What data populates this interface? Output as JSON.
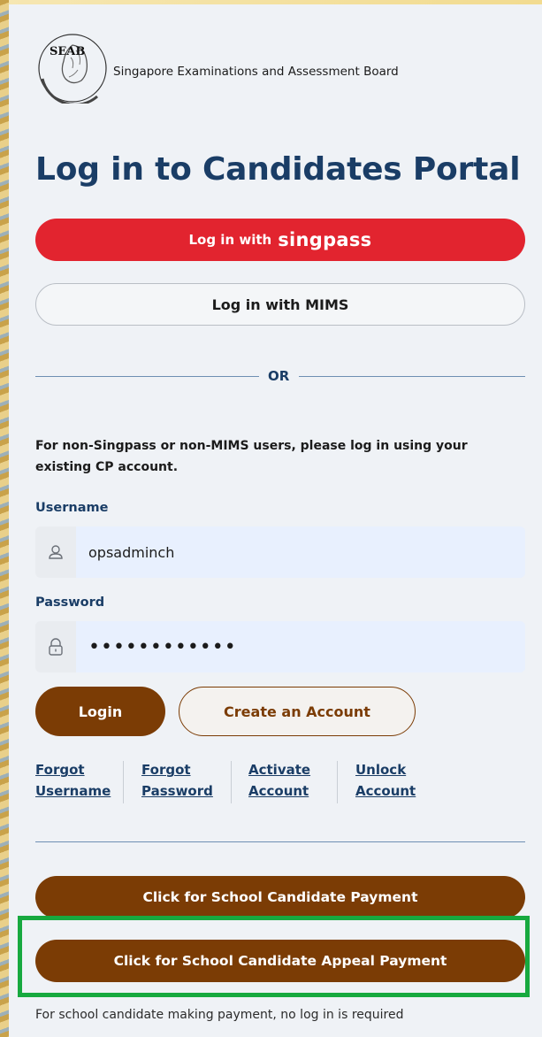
{
  "header": {
    "logo_text": "SEAB",
    "org_name": "Singapore Examinations and Assessment Board"
  },
  "page_title": "Log in to Candidates Portal",
  "singpass_button": {
    "prefix": "Log in with",
    "brand": "singpass"
  },
  "mims_button": {
    "label": "Log in with MIMS"
  },
  "divider_text": "OR",
  "info_text": "For non-Singpass or non-MIMS users, please log in using your existing CP account.",
  "username": {
    "label": "Username",
    "value": "opsadminch",
    "icon": "user-icon"
  },
  "password": {
    "label": "Password",
    "value": "••••••••••••",
    "icon": "lock-icon"
  },
  "login_button": "Login",
  "create_account_button": "Create an Account",
  "links": [
    {
      "line1": "Forgot",
      "line2": "Username"
    },
    {
      "line1": "Forgot",
      "line2": "Password"
    },
    {
      "line1": "Activate",
      "line2": "Account"
    },
    {
      "line1": "Unlock",
      "line2": "Account"
    }
  ],
  "payment_button": "Click for School Candidate Payment",
  "appeal_payment_button": "Click for School Candidate Appeal Payment",
  "footnote": "For school candidate making payment, no log in is required",
  "colors": {
    "title": "#1a3d66",
    "singpass_red": "#e2242f",
    "brown": "#7b3c05",
    "highlight_green": "#17a93f",
    "panel_bg": "#eff2f6"
  }
}
